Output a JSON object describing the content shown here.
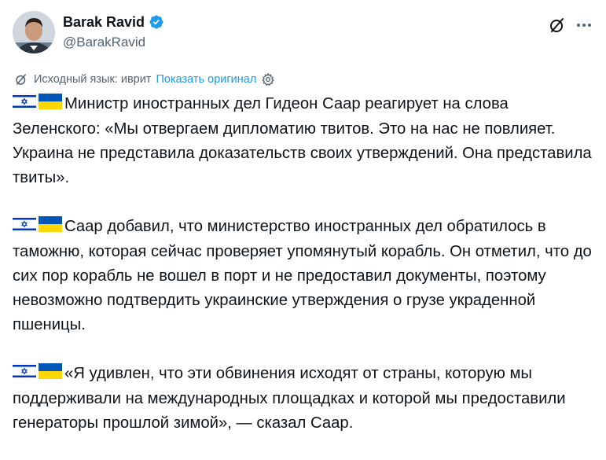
{
  "author": {
    "name": "Barak Ravid",
    "handle": "@BarakRavid"
  },
  "translation": {
    "source_label": "Исходный язык: иврит",
    "show_original": "Показать оригинал"
  },
  "paragraphs": [
    "Министр иностранных дел Гидеон Саар реагирует на слова Зеленского: «Мы отвергаем дипломатию твитов. Это на нас не повлияет. Украина не представила доказательств своих утверждений. Она представила твиты».",
    "Саар добавил, что министерство иностранных дел обратилось в таможню, которая сейчас проверяет упомянутый корабль. Он отметил, что до сих пор корабль не вошел в порт и не предоставил документы, поэтому невозможно подтвердить украинские утверждения о грузе украденной пшеницы.",
    "«Я удивлен, что эти обвинения исходят от страны, которую мы поддерживали на международных площадках и которой мы предоставили генераторы прошлой зимой», — сказал Саар."
  ],
  "colors": {
    "link": "#1d9bf0",
    "muted": "#536471",
    "text": "#0f1419",
    "verified": "#1d9bf0"
  },
  "icons": [
    "verified-badge-icon",
    "grok-icon",
    "more-icon",
    "translate-icon",
    "settings-gear-icon",
    "israel-flag-icon",
    "ukraine-flag-icon"
  ]
}
